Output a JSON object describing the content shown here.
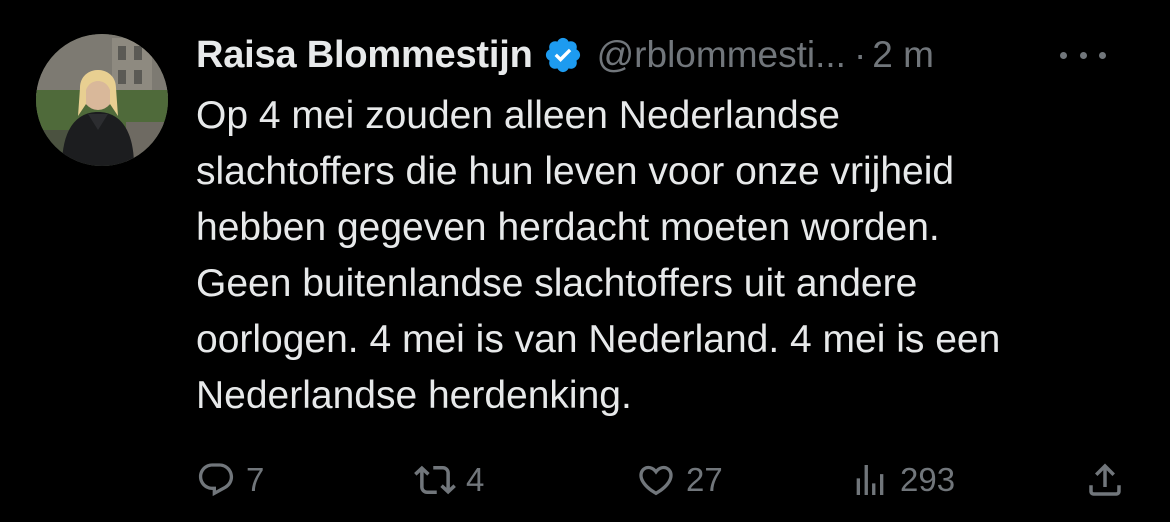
{
  "tweet": {
    "author_name": "Raisa Blommestijn",
    "author_handle": "@rblommesti...",
    "separator": "·",
    "time": "2 m",
    "text_lines": [
      "Op 4 mei zouden alleen Nederlandse",
      "slachtoffers die hun leven voor onze vrijheid",
      "hebben gegeven herdacht moeten worden.",
      "Geen buitenlandse slachtoffers uit andere",
      "oorlogen. 4 mei is van Nederland. 4 mei is een",
      "Nederlandse herdenking."
    ]
  },
  "actions": {
    "replies": "7",
    "retweets": "4",
    "likes": "27",
    "views": "293"
  },
  "icons": {
    "verified": "verified-badge-icon",
    "more": "more-horizontal-icon",
    "reply": "reply-icon",
    "retweet": "retweet-icon",
    "like": "heart-icon",
    "views": "views-chart-icon",
    "share": "share-icon"
  },
  "colors": {
    "background": "#000000",
    "text": "#e7e9ea",
    "secondary": "#71767b",
    "verified": "#1d9bf0"
  }
}
